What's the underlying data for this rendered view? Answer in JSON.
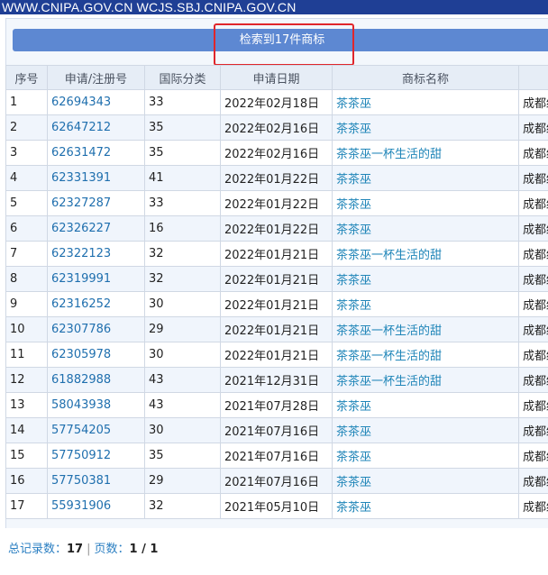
{
  "header": {
    "url_text": "WWW.CNIPA.GOV.CN WCJS.SBJ.CNIPA.GOV.CN"
  },
  "result": {
    "text": "检索到17件商标"
  },
  "table": {
    "columns": [
      "序号",
      "申请/注册号",
      "国际分类",
      "申请日期",
      "商标名称",
      ""
    ],
    "rows": [
      {
        "no": "1",
        "reg": "62694343",
        "cls": "33",
        "date": "2022年02月18日",
        "name": "茶茶巫",
        "applicant": "成都织"
      },
      {
        "no": "2",
        "reg": "62647212",
        "cls": "35",
        "date": "2022年02月16日",
        "name": "茶茶巫",
        "applicant": "成都织"
      },
      {
        "no": "3",
        "reg": "62631472",
        "cls": "35",
        "date": "2022年02月16日",
        "name": "茶茶巫一杯生活的甜",
        "applicant": "成都织"
      },
      {
        "no": "4",
        "reg": "62331391",
        "cls": "41",
        "date": "2022年01月22日",
        "name": "茶茶巫",
        "applicant": "成都织"
      },
      {
        "no": "5",
        "reg": "62327287",
        "cls": "33",
        "date": "2022年01月22日",
        "name": "茶茶巫",
        "applicant": "成都织"
      },
      {
        "no": "6",
        "reg": "62326227",
        "cls": "16",
        "date": "2022年01月22日",
        "name": "茶茶巫",
        "applicant": "成都织"
      },
      {
        "no": "7",
        "reg": "62322123",
        "cls": "32",
        "date": "2022年01月21日",
        "name": "茶茶巫一杯生活的甜",
        "applicant": "成都织"
      },
      {
        "no": "8",
        "reg": "62319991",
        "cls": "32",
        "date": "2022年01月21日",
        "name": "茶茶巫",
        "applicant": "成都织"
      },
      {
        "no": "9",
        "reg": "62316252",
        "cls": "30",
        "date": "2022年01月21日",
        "name": "茶茶巫",
        "applicant": "成都织"
      },
      {
        "no": "10",
        "reg": "62307786",
        "cls": "29",
        "date": "2022年01月21日",
        "name": "茶茶巫一杯生活的甜",
        "applicant": "成都织"
      },
      {
        "no": "11",
        "reg": "62305978",
        "cls": "30",
        "date": "2022年01月21日",
        "name": "茶茶巫一杯生活的甜",
        "applicant": "成都织"
      },
      {
        "no": "12",
        "reg": "61882988",
        "cls": "43",
        "date": "2021年12月31日",
        "name": "茶茶巫一杯生活的甜",
        "applicant": "成都织"
      },
      {
        "no": "13",
        "reg": "58043938",
        "cls": "43",
        "date": "2021年07月28日",
        "name": "茶茶巫",
        "applicant": "成都织"
      },
      {
        "no": "14",
        "reg": "57754205",
        "cls": "30",
        "date": "2021年07月16日",
        "name": "茶茶巫",
        "applicant": "成都织"
      },
      {
        "no": "15",
        "reg": "57750912",
        "cls": "35",
        "date": "2021年07月16日",
        "name": "茶茶巫",
        "applicant": "成都织"
      },
      {
        "no": "16",
        "reg": "57750381",
        "cls": "29",
        "date": "2021年07月16日",
        "name": "茶茶巫",
        "applicant": "成都织"
      },
      {
        "no": "17",
        "reg": "55931906",
        "cls": "32",
        "date": "2021年05月10日",
        "name": "茶茶巫",
        "applicant": "成都织"
      }
    ]
  },
  "footer": {
    "total_label": "总记录数：",
    "total_value": "17",
    "separator": "|",
    "pages_label": "页数：",
    "pages_value": "1 / 1"
  },
  "colors": {
    "topbar": "#1f3f95",
    "result_bar": "#5d88d2",
    "highlight_border": "#e0262b",
    "link": "#1f6fae"
  }
}
